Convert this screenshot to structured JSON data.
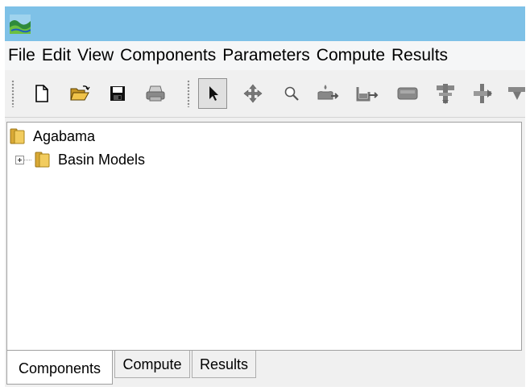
{
  "window": {
    "title": ""
  },
  "menu": [
    "File",
    "Edit",
    "View",
    "Components",
    "Parameters",
    "Compute",
    "Results"
  ],
  "toolbar": {
    "buttons": [
      {
        "icon": "new-file-icon",
        "label": ""
      },
      {
        "icon": "open-folder-icon",
        "label": ""
      },
      {
        "icon": "save-icon",
        "label": ""
      },
      {
        "icon": "print-icon",
        "label": ""
      },
      {
        "icon": "pointer-icon",
        "label": "",
        "pressed": true
      },
      {
        "icon": "pan-icon",
        "label": ""
      },
      {
        "icon": "zoom-icon",
        "label": ""
      },
      {
        "icon": "subbasin-icon",
        "label": ""
      },
      {
        "icon": "reach-icon",
        "label": ""
      },
      {
        "icon": "reservoir-icon",
        "label": ""
      },
      {
        "icon": "junction-icon",
        "label": ""
      },
      {
        "icon": "diversion-icon",
        "label": ""
      },
      {
        "icon": "sink-icon",
        "label": ""
      }
    ]
  },
  "tree": {
    "root": {
      "label": "Agabama",
      "icon": "folder-icon"
    },
    "children": [
      {
        "label": "Basin Models",
        "icon": "folder-icon",
        "expandable": true
      }
    ]
  },
  "tabs": [
    {
      "label": "Components",
      "active": true
    },
    {
      "label": "Compute",
      "active": false
    },
    {
      "label": "Results",
      "active": false
    }
  ],
  "colors": {
    "titlebar": "#7ec1e7",
    "folder": "#e8c25a",
    "pressed_button": "#c9c9c9"
  }
}
